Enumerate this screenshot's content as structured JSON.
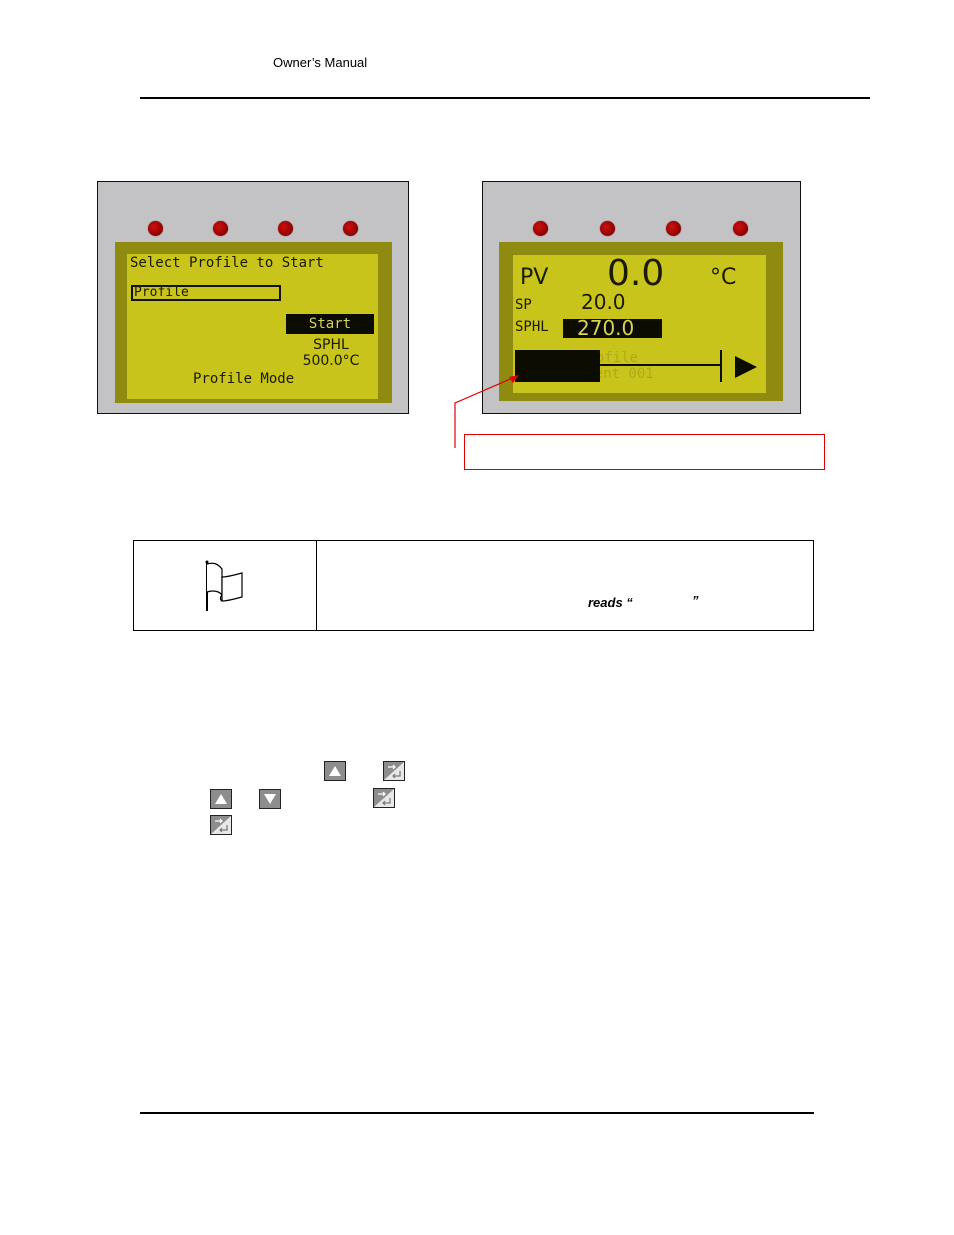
{
  "header": {
    "title": "Owner’s Manual"
  },
  "figures": {
    "left_display": {
      "title": "Select Profile to Start",
      "profile_field": "Profile",
      "start_button": "Start",
      "setpoint_label": "SPHL",
      "setpoint_value": "500.0°C",
      "mode_label": "Profile Mode",
      "leds": [
        "led",
        "led",
        "led",
        "led"
      ]
    },
    "right_display": {
      "pv_label": "PV",
      "pv_value": "0.0",
      "unit": "°C",
      "sp_label": "SP",
      "sp_value": "20.0",
      "sphl_label": "SPHL",
      "sphl_value": "270.0",
      "profile_label": "Profile",
      "segment_label": "Segment 001",
      "play_icon": "play-icon",
      "leds": [
        "led",
        "led",
        "led",
        "led"
      ]
    },
    "callout": {
      "text": "",
      "color": "#e00000"
    }
  },
  "note": {
    "icon": "flag-icon",
    "reads_text": "reads “",
    "close_quote": "”"
  },
  "keys": {
    "up": "up-arrow-key-icon",
    "down": "down-arrow-key-icon",
    "enter": "enter-key-icon"
  },
  "colors": {
    "lcd_background": "#c8c41c",
    "lcd_bezel": "#8f8a10",
    "panel": "#c3c3c5",
    "led": "#c00000",
    "callout": "#e00000"
  }
}
